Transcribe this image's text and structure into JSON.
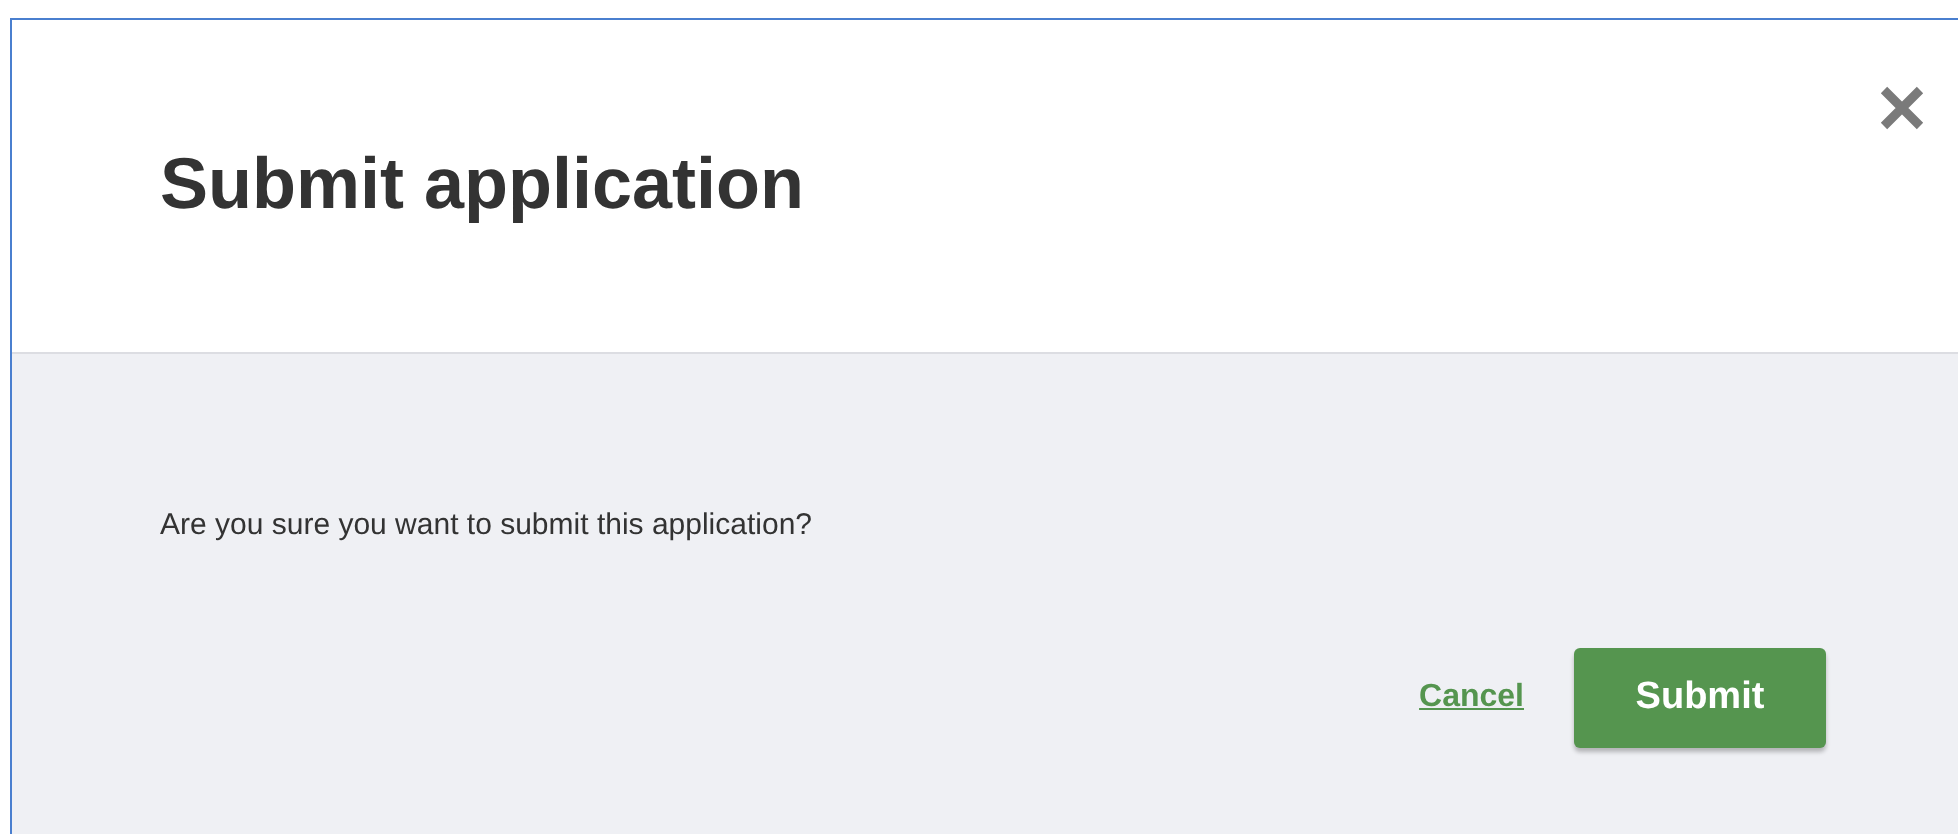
{
  "dialog": {
    "title": "Submit application",
    "message": "Are you sure you want to submit this application?",
    "buttons": [
      {
        "kind": "link",
        "label": "Cancel"
      },
      {
        "kind": "primary",
        "label": "Submit"
      }
    ]
  }
}
